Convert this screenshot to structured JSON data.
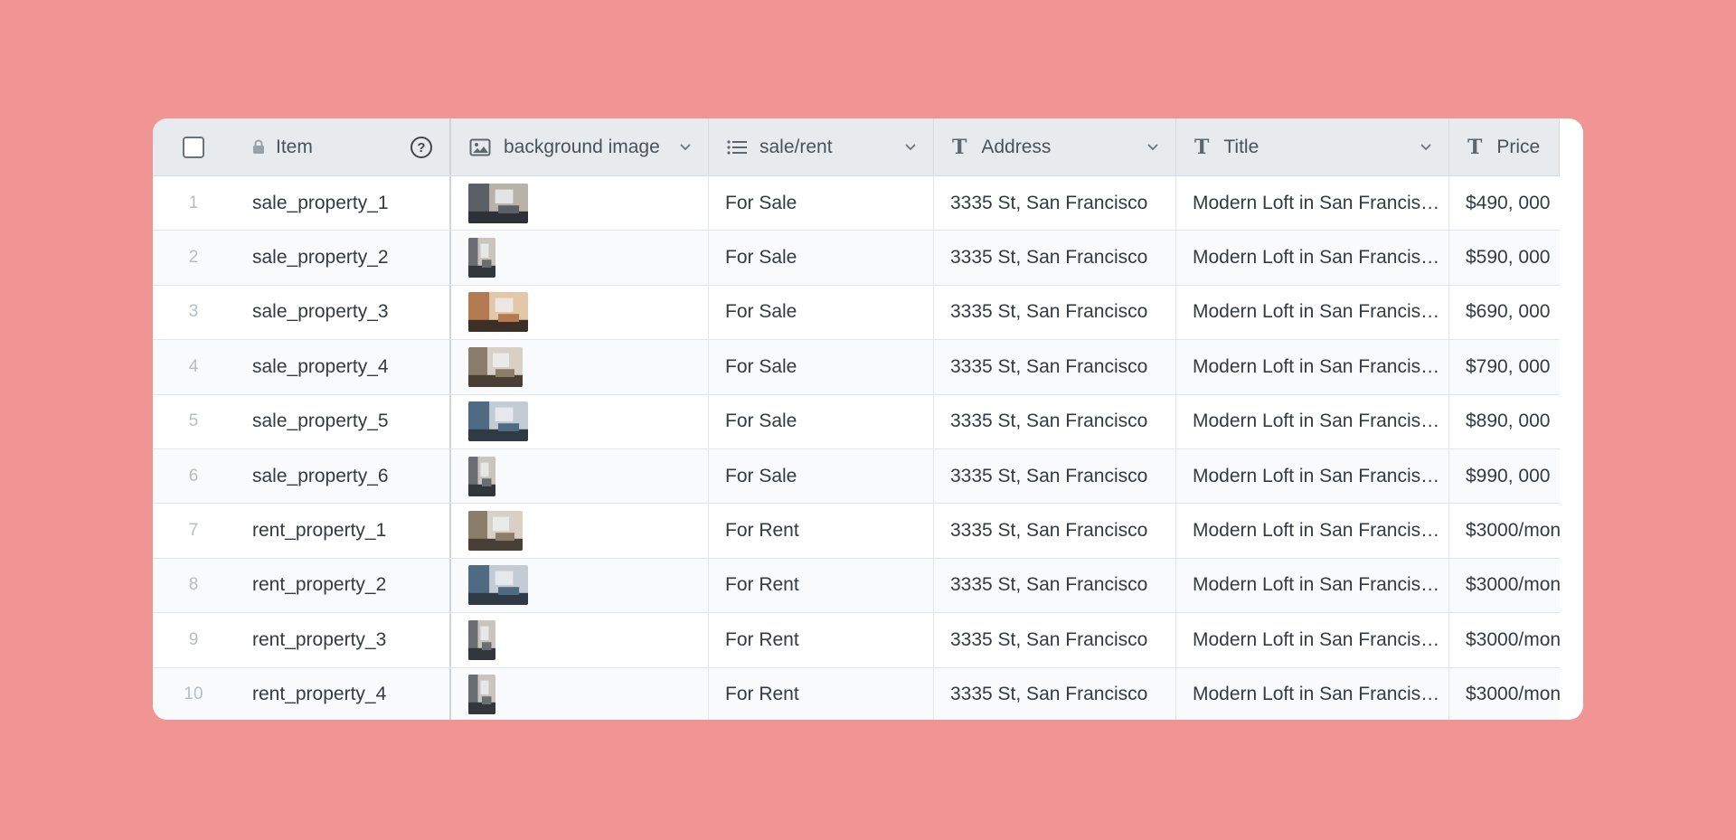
{
  "header": {
    "item": "Item",
    "background_image": "background image",
    "sale_rent": "sale/rent",
    "address": "Address",
    "title": "Title",
    "price": "Price"
  },
  "rows": [
    {
      "num": "1",
      "item": "sale_property_1",
      "sale": "For Sale",
      "address": "3335 St, San Francisco",
      "title": "Modern Loft in San Francisco",
      "price": "$490, 000"
    },
    {
      "num": "2",
      "item": "sale_property_2",
      "sale": "For Sale",
      "address": "3335 St, San Francisco",
      "title": "Modern Loft in San Francisco",
      "price": "$590, 000"
    },
    {
      "num": "3",
      "item": "sale_property_3",
      "sale": "For Sale",
      "address": "3335 St, San Francisco",
      "title": "Modern Loft in San Francisco",
      "price": "$690, 000"
    },
    {
      "num": "4",
      "item": "sale_property_4",
      "sale": "For Sale",
      "address": "3335 St, San Francisco",
      "title": "Modern Loft in San Francisco",
      "price": "$790, 000"
    },
    {
      "num": "5",
      "item": "sale_property_5",
      "sale": "For Sale",
      "address": "3335 St, San Francisco",
      "title": "Modern Loft in San Francisco",
      "price": "$890, 000"
    },
    {
      "num": "6",
      "item": "sale_property_6",
      "sale": "For Sale",
      "address": "3335 St, San Francisco",
      "title": "Modern Loft in San Francisco",
      "price": "$990, 000"
    },
    {
      "num": "7",
      "item": "rent_property_1",
      "sale": "For Rent",
      "address": "3335 St, San Francisco",
      "title": "Modern Loft in San Francisco",
      "price": "$3000/mon"
    },
    {
      "num": "8",
      "item": "rent_property_2",
      "sale": "For Rent",
      "address": "3335 St, San Francisco",
      "title": "Modern Loft in San Francisco",
      "price": "$3000/mon"
    },
    {
      "num": "9",
      "item": "rent_property_3",
      "sale": "For Rent",
      "address": "3335 St, San Francisco",
      "title": "Modern Loft in San Francisco",
      "price": "$3000/mon"
    },
    {
      "num": "10",
      "item": "rent_property_4",
      "sale": "For Rent",
      "address": "3335 St, San Francisco",
      "title": "Modern Loft in San Francisco",
      "price": "$3000/mon"
    }
  ],
  "thumbs": [
    "wide",
    "narrow",
    "wide-warm",
    "medium",
    "wide-blue",
    "narrow",
    "medium",
    "wide-blue",
    "narrow",
    "narrow"
  ],
  "colors": {
    "background": "#f09593",
    "header": "#e7ebee",
    "row_alt": "#f8fafc"
  }
}
